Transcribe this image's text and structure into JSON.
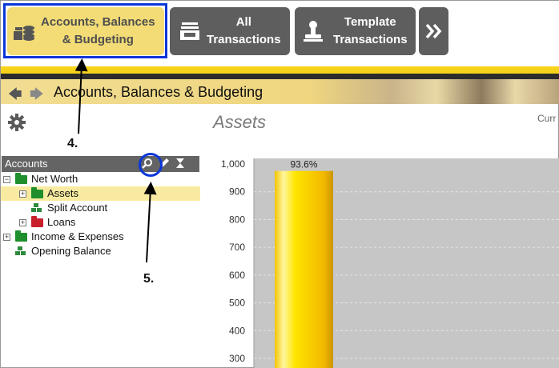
{
  "toolbar": {
    "accounts_label_1": "Accounts, Balances",
    "accounts_label_2": "& Budgeting",
    "all_label_1": "All",
    "all_label_2": "Transactions",
    "template_label_1": "Template",
    "template_label_2": "Transactions",
    "more_icon": "double-chevron-right-icon"
  },
  "breadcrumb": {
    "title": "Accounts, Balances & Budgeting",
    "back_icon": "arrow-left-icon",
    "forward_icon": "arrow-right-icon"
  },
  "header": {
    "section_title": "Assets",
    "currency_fragment": "Curr",
    "settings_icon": "gear-icon"
  },
  "accounts_panel": {
    "title": "Accounts",
    "tools": [
      "search-icon",
      "pencil-icon",
      "collapse-icon"
    ]
  },
  "tree": {
    "net_worth": "Net Worth",
    "assets": "Assets",
    "split_account": "Split Account",
    "loans": "Loans",
    "income_expenses": "Income & Expenses",
    "opening_balance": "Opening Balance"
  },
  "annotations": {
    "step4": "4.",
    "step5": "5."
  },
  "colors": {
    "accent_yellow": "#f7d21b",
    "selected_button": "#f3dc76",
    "callout_blue": "#0a36d8",
    "dark_button": "#5e5e5e"
  },
  "chart_data": {
    "type": "bar",
    "categories": [
      ""
    ],
    "values": [
      975
    ],
    "data_labels": [
      "93.6%"
    ],
    "ylim": [
      250,
      1000
    ],
    "ytick_labels": [
      "1,000",
      "900",
      "800",
      "700",
      "600",
      "500",
      "400",
      "300"
    ],
    "yticks": [
      1000,
      900,
      800,
      700,
      600,
      500,
      400,
      300
    ],
    "grid": true
  }
}
